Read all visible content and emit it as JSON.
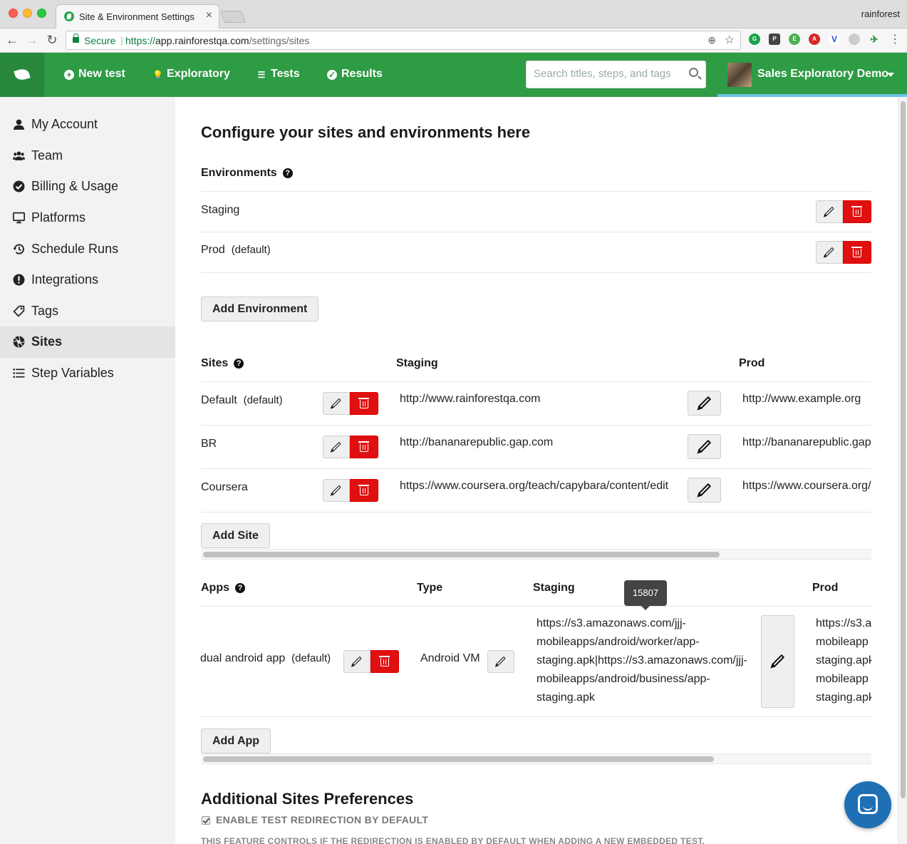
{
  "browser": {
    "tab_title": "Site & Environment Settings",
    "profile": "rainforest",
    "secure_label": "Secure",
    "url_scheme": "https://",
    "url_host": "app.rainforestqa.com",
    "url_path": "/settings/sites"
  },
  "nav": {
    "new_test": "New test",
    "exploratory": "Exploratory",
    "tests": "Tests",
    "results": "Results",
    "search_placeholder": "Search titles, steps, and tags",
    "account_name": "Sales Exploratory Demo"
  },
  "sidebar": {
    "items": [
      {
        "label": "My Account",
        "icon": "user-icon"
      },
      {
        "label": "Team",
        "icon": "team-icon"
      },
      {
        "label": "Billing & Usage",
        "icon": "check-circle-icon"
      },
      {
        "label": "Platforms",
        "icon": "monitor-icon"
      },
      {
        "label": "Schedule Runs",
        "icon": "history-icon"
      },
      {
        "label": "Integrations",
        "icon": "exclamation-circle-icon"
      },
      {
        "label": "Tags",
        "icon": "tag-icon"
      },
      {
        "label": "Sites",
        "icon": "aperture-icon",
        "active": true
      },
      {
        "label": "Step Variables",
        "icon": "list-icon"
      }
    ]
  },
  "page": {
    "title": "Configure your sites and environments here",
    "environments_heading": "Environments",
    "environments": [
      {
        "name": "Staging",
        "suffix": ""
      },
      {
        "name": "Prod",
        "suffix": "(default)"
      }
    ],
    "add_environment": "Add Environment",
    "sites_heading": "Sites",
    "sites_columns": [
      "Staging",
      "Prod"
    ],
    "sites": [
      {
        "name": "Default",
        "suffix": "(default)",
        "staging": "http://www.rainforestqa.com",
        "prod": "http://www.example.org"
      },
      {
        "name": "BR",
        "suffix": "",
        "staging": "http://bananarepublic.gap.com",
        "prod": "http://bananarepublic.gap.com"
      },
      {
        "name": "Coursera",
        "suffix": "",
        "staging": "https://www.coursera.org/teach/capybara/content/edit",
        "prod": "https://www.coursera.org/teach/capybara/content/edit"
      }
    ],
    "add_site": "Add Site",
    "apps_heading": "Apps",
    "apps_columns": [
      "Type",
      "Staging",
      "Prod"
    ],
    "apps": [
      {
        "name": "dual android app",
        "suffix": "(default)",
        "type": "Android VM",
        "staging_lines": [
          "https://s3.amazonaws.com/jjj-",
          "mobileapps/android/worker/app-",
          "staging.apk|https://s3.amazonaws.com/jjj-",
          "mobileapps/android/business/app-",
          "staging.apk"
        ],
        "prod_lines": [
          "https://s3.a",
          "mobileapp",
          "staging.apk",
          "mobileapp",
          "staging.apk"
        ]
      }
    ],
    "tooltip": "15807",
    "add_app": "Add App",
    "prefs_heading": "Additional Sites Preferences",
    "redirect_label": "ENABLE TEST REDIRECTION BY DEFAULT",
    "redirect_checked": true,
    "redirect_help": "THIS FEATURE CONTROLS IF THE REDIRECTION IS ENABLED BY DEFAULT WHEN ADDING A NEW EMBEDDED TEST."
  },
  "colors": {
    "brand_green": "#2e9b45",
    "danger_red": "#e01010",
    "chat_blue": "#1f6fb4"
  }
}
